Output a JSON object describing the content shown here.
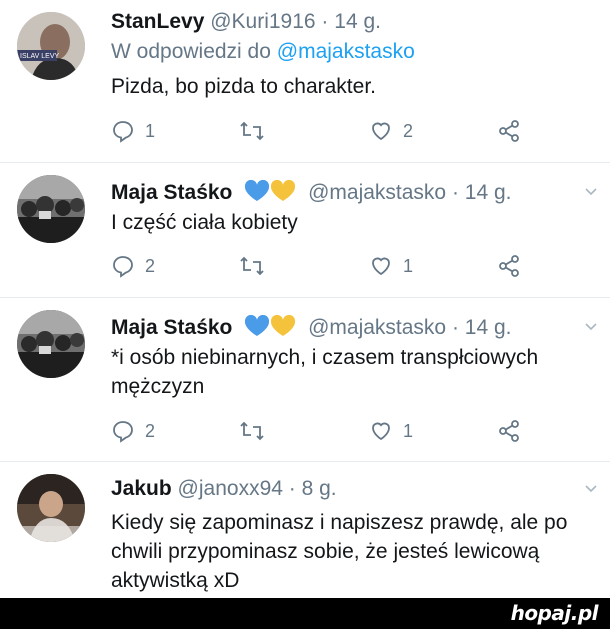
{
  "tweets": [
    {
      "name": "StanLevy",
      "handle": "@Kuri1916 · 14 g.",
      "reply_prefix": "W odpowiedzi do ",
      "reply_mention": "@majakstasko",
      "text": "Pizda, bo pizda to charakter.",
      "avatar_caption": "ISLAV LEVY",
      "replies": "1",
      "retweets": "",
      "likes": "2"
    },
    {
      "name": "Maja Staśko",
      "handle": "@majakstasko · 14 g.",
      "text": "I część ciała kobiety",
      "replies": "2",
      "retweets": "",
      "likes": "1"
    },
    {
      "name": "Maja Staśko",
      "handle": "@majakstasko · 14 g.",
      "text": "*i osób niebinarnych, i czasem transpłciowych mężczyzn",
      "replies": "2",
      "retweets": "",
      "likes": "1"
    },
    {
      "name": "Jakub",
      "handle": "@janoxx94 · 8 g.",
      "text": "Kiedy się zapominasz i napiszesz prawdę, ale po chwili przypominasz sobie, że jesteś lewicową aktywistką xD"
    }
  ],
  "icons": {
    "reply": "reply-icon",
    "retweet": "retweet-icon",
    "like": "heart-icon",
    "share": "share-icon",
    "more": "chevron-down-icon"
  },
  "colors": {
    "name": "#14171a",
    "secondary": "#657786",
    "mention": "#1da1f2",
    "heart_blue": "#4a9be8",
    "heart_yellow": "#f5c33b"
  },
  "watermark": "hopaj.pl"
}
